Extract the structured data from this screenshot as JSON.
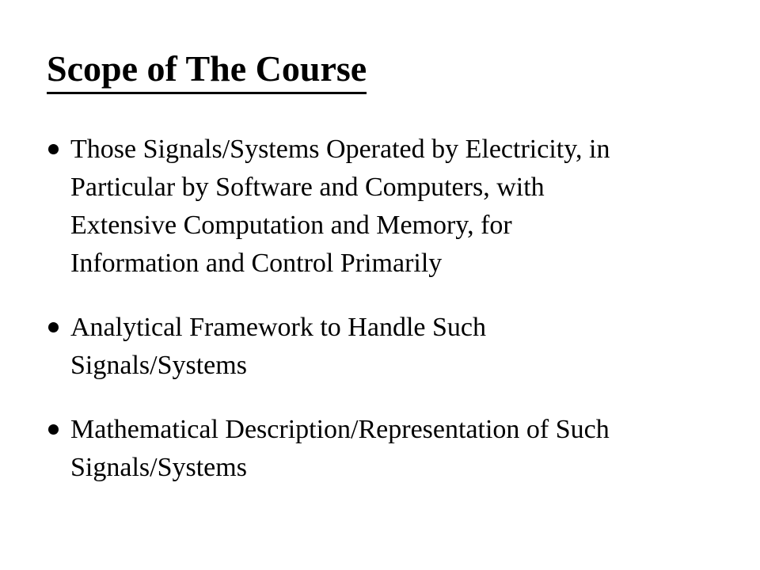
{
  "slide": {
    "title": "Scope of The Course",
    "bullets": [
      {
        "lines": [
          "Those Signals/Systems Operated by Electricity, in",
          "Particular by Software and Computers, with",
          "Extensive Computation and Memory, for",
          "Information and Control Primarily"
        ]
      },
      {
        "lines": [
          "Analytical Framework to Handle Such",
          "Signals/Systems"
        ]
      },
      {
        "lines": [
          "Mathematical Description/Representation of Such",
          "Signals/Systems"
        ]
      }
    ]
  }
}
